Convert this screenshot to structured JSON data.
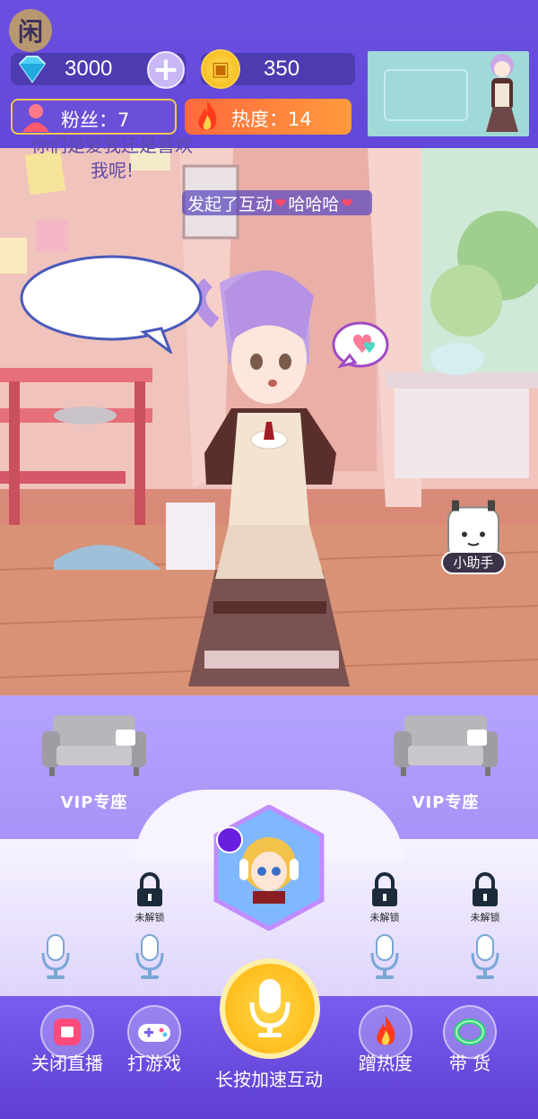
{
  "top": {
    "logo_glyph": "闲",
    "diamonds": "3000",
    "coins": "350",
    "fans_label": "粉丝：7",
    "heat_label": "热度：14"
  },
  "stage": {
    "speech_bubble": "你们是爱我还是喜欢我呢!",
    "marquee_text_1": "发起了互动",
    "marquee_text_2": "哈哈哈",
    "assistant_label": "小助手"
  },
  "seats": {
    "vip_left": "VIP专座",
    "vip_right": "VIP专座",
    "locked_label": "未解锁"
  },
  "bottom": {
    "close_live": "关闭直播",
    "play_game": "打游戏",
    "hold_boost": "长按加速互动",
    "give_heat": "蹭热度",
    "sell_goods": "带 货"
  },
  "colors": {
    "primary": "#6c4fe0",
    "accent_gold": "#f2c84a",
    "heat_orange": "#ff6a3d"
  }
}
